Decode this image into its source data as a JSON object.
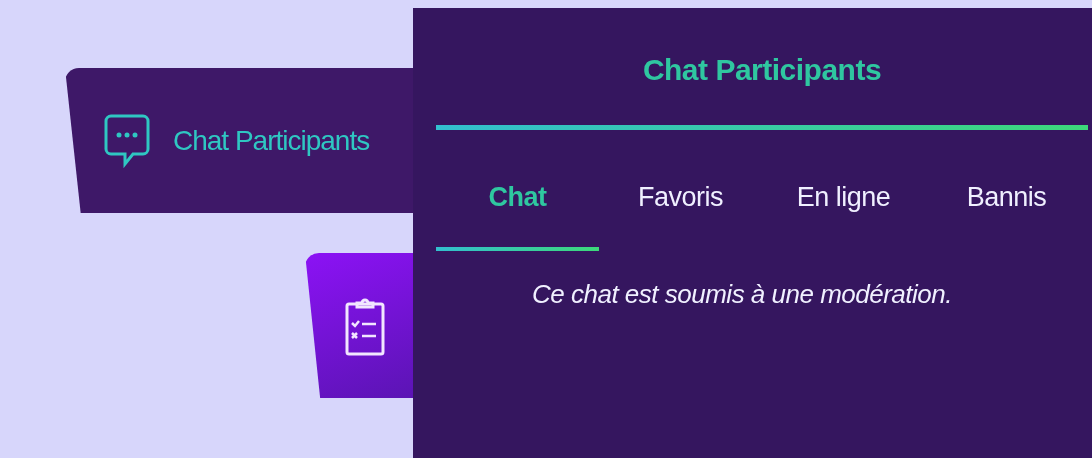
{
  "side_tabs": [
    {
      "kind": "chat",
      "label": "Chat Participants",
      "selected": true
    },
    {
      "kind": "checklist",
      "selected": false
    }
  ],
  "panel": {
    "title": "Chat Participants",
    "tabs": [
      {
        "label": "Chat",
        "selected": true
      },
      {
        "label": "Favoris",
        "selected": false
      },
      {
        "label": "En ligne",
        "selected": false
      },
      {
        "label": "Bannis",
        "selected": false
      }
    ],
    "notice": "Ce chat est soumis à une modération."
  }
}
